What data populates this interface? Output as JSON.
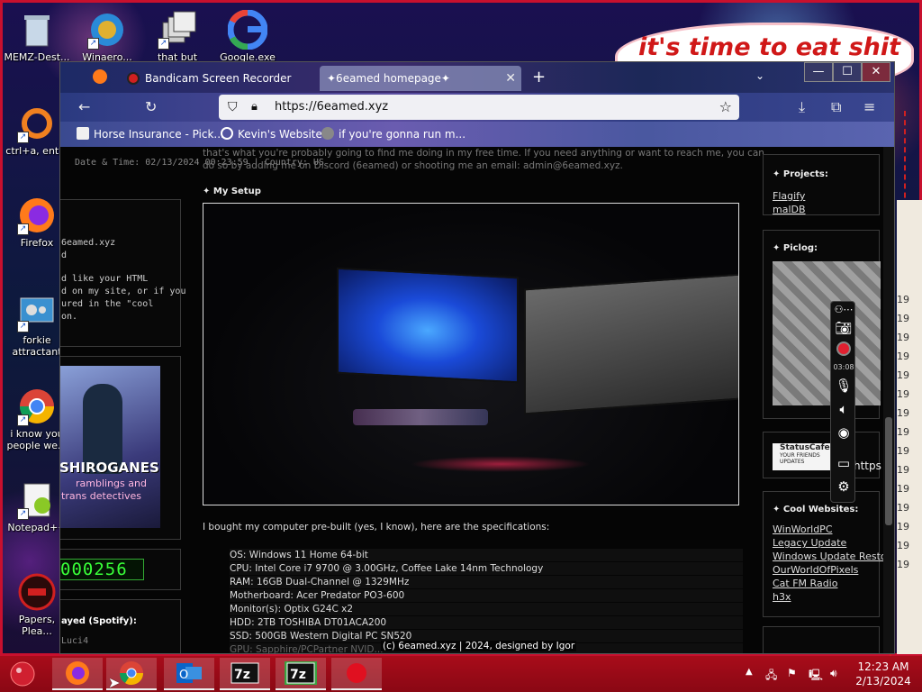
{
  "desktop": {
    "bubble_text": "it's time to eat shit",
    "icons": [
      {
        "name": "recycle-bin",
        "label": "MEMZ-Dest..."
      },
      {
        "name": "winaero",
        "label": "Winaero..."
      },
      {
        "name": "that-but-when",
        "label": "that but whe..."
      },
      {
        "name": "google",
        "label": "Google.exe"
      },
      {
        "name": "ctrl-a",
        "label": "ctrl+a, ent..."
      },
      {
        "name": "firefox",
        "label": "Firefox"
      },
      {
        "name": "forkie",
        "label": "forkie attractant"
      },
      {
        "name": "i-know-you",
        "label": "i know you people we..."
      },
      {
        "name": "notepad",
        "label": "Notepad++"
      },
      {
        "name": "papers-please",
        "label": "Papers, Plea..."
      }
    ]
  },
  "browser": {
    "tabs": [
      {
        "label": "Bandicam Screen Recorder Do..."
      },
      {
        "label": "✦6eamed homepage✦"
      }
    ],
    "new_tab": "+",
    "window_buttons": {
      "minimize": "—",
      "maximize": "☐",
      "close": "✕"
    },
    "url": "https://6eamed.xyz",
    "bookmarks": [
      {
        "label": "Horse Insurance - Pick..."
      },
      {
        "label": "Kevin's Website"
      },
      {
        "label": "if you're gonna run m..."
      }
    ]
  },
  "page": {
    "datetime": "Date & Time: 02/13/2024 00:23:59 | Country: US",
    "intro_line1": "that's what you're probably going to find me doing in my free time. If you need anything or want to reach me, you can",
    "intro_line2": "do so by adding me on Discord (6eamed) or shooting me an email: admin@6eamed.xyz.",
    "left_fragments": {
      "site": "6eamed.xyz",
      "d": "d",
      "html1": "d like your HTML",
      "html2": "d on my site, or if you",
      "html3": "ured in the \"cool",
      "html4": "on.",
      "counter": "000256",
      "spotify": "ayed (Spotify):",
      "track": "Luci4"
    },
    "book_text1": "SHIROGANES",
    "book_text2": "ramblings and",
    "book_text3": "trans detectives",
    "setup_title": "My Setup",
    "setup_desc": "I bought my computer pre-built (yes, I know), here are the specifications:",
    "specs": [
      "OS: Windows 11 Home 64-bit",
      "CPU: Intel Core i7 9700 @ 3.00GHz, Coffee Lake 14nm Technology",
      "RAM: 16GB Dual-Channel @ 1329MHz",
      "Motherboard: Acer Predator PO3-600",
      "Monitor(s): Optix G24C x2",
      "HDD: 2TB TOSHIBA DT01ACA200",
      "SSD: 500GB Western Digital PC SN520",
      "GPU: Sapphire/PCPartner NVID..."
    ],
    "footer": "(c) 6eamed.xyz | 2024, designed by Igor",
    "projects_title": "Projects:",
    "projects": [
      "Flagify",
      "malDB"
    ],
    "piclog_title": "Piclog:",
    "statuscafe_title": "StatusCafe",
    "statuscafe_sub1": "YOUR FRIENDS",
    "statuscafe_sub2": "UPDATES",
    "statuscafe_link": "https",
    "websites_title": "Cool Websites:",
    "websites": [
      "WinWorldPC",
      "Legacy Update",
      "Windows Update Resto...",
      "OurWorldOfPixels",
      "Cat FM Radio",
      "h3x"
    ],
    "right_edge_numbers": [
      "19",
      "19",
      "19",
      "19",
      "19",
      "19",
      "19",
      "19",
      "19",
      "19",
      "19",
      "19",
      "19",
      "19",
      "19"
    ]
  },
  "bandicam": {
    "timer": "03:08"
  },
  "taskbar": {
    "apps": [
      "Firefox",
      "Chrome",
      "Outlook",
      "7-Zip",
      "7-Zip",
      "Bandicam"
    ],
    "time": "12:23 AM",
    "date": "2/13/2024"
  }
}
